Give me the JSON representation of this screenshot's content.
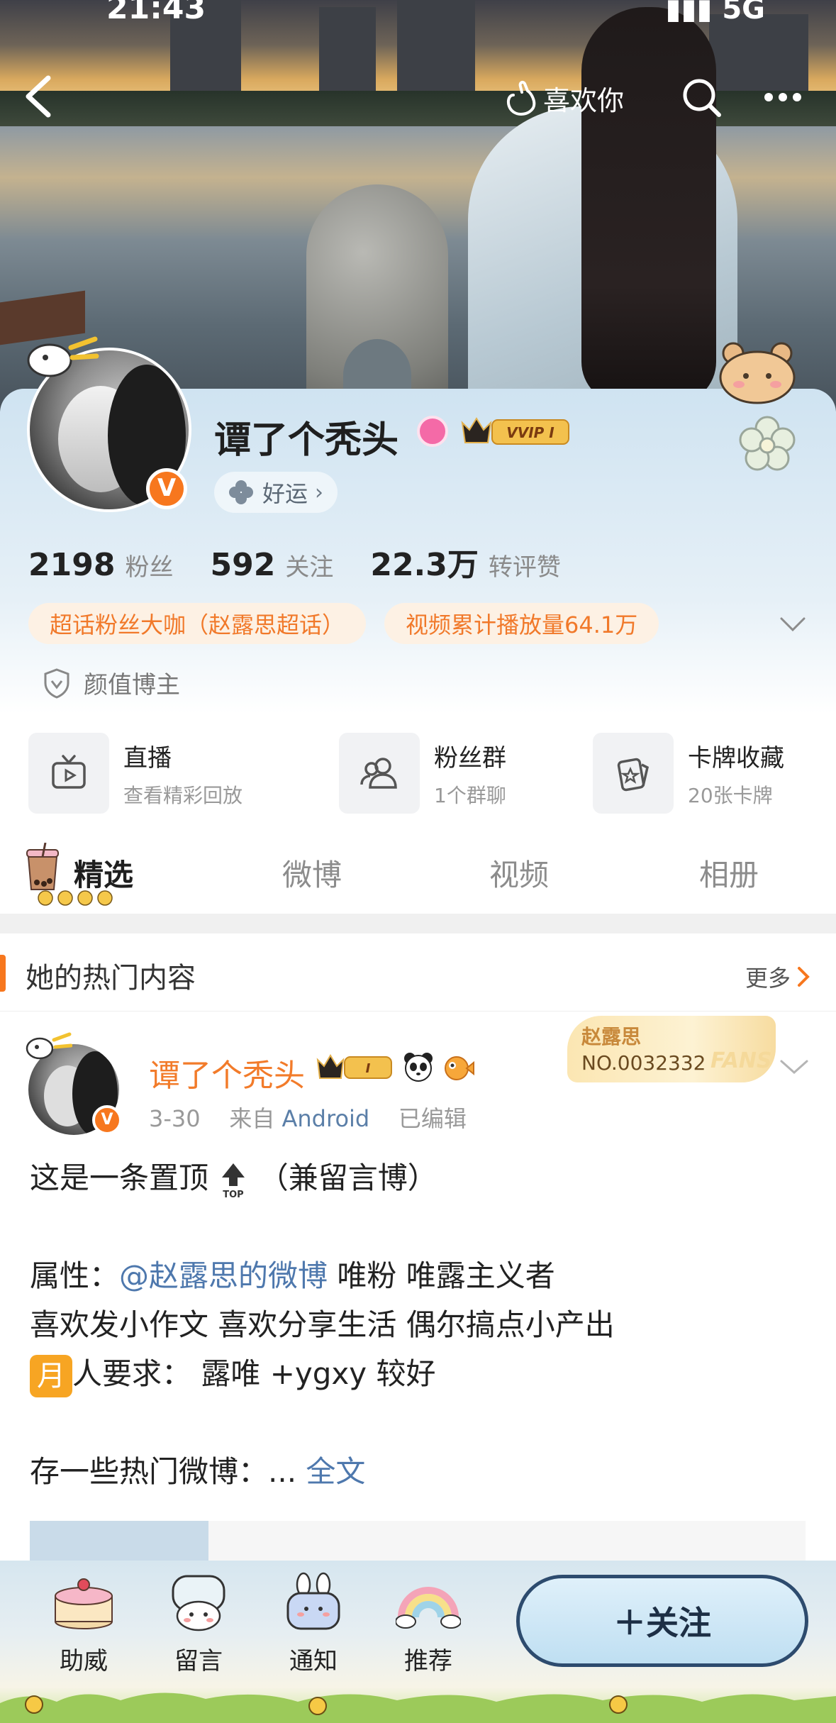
{
  "status_bar": {
    "time": "21:43",
    "network": "5G"
  },
  "top_nav": {
    "like_label": "喜欢你"
  },
  "profile": {
    "name": "谭了个秃头",
    "vip_label": "VVIP I",
    "luck_label": "好运",
    "verified_badge": "V",
    "stats": [
      {
        "num": "2198",
        "label": "粉丝"
      },
      {
        "num": "592",
        "label": "关注"
      },
      {
        "num": "22.3万",
        "label": "转评赞"
      }
    ],
    "tags": [
      "超话粉丝大咖（赵露思超话）",
      "视频累计播放量64.1万"
    ],
    "certification": "颜值博主"
  },
  "services": [
    {
      "title": "直播",
      "sub": "查看精彩回放",
      "icon": "tv-icon"
    },
    {
      "title": "粉丝群",
      "sub": "1个群聊",
      "icon": "group-icon"
    },
    {
      "title": "卡牌收藏",
      "sub": "20张卡牌",
      "icon": "card-icon"
    }
  ],
  "tabs": [
    "精选",
    "微博",
    "视频",
    "相册"
  ],
  "hot_section": {
    "title": "她的热门内容",
    "more": "更多"
  },
  "post": {
    "author": "谭了个秃头",
    "badge_level": "I",
    "date": "3-30",
    "source_prefix": "来自",
    "source": "Android",
    "edited": "已编辑",
    "fans_card": {
      "name": "赵露思",
      "number": "NO.0032332",
      "watermark": "FANS"
    },
    "line1_a": "这是一条置顶",
    "line1_b": "（兼留言博）",
    "line2_a": "属性：",
    "line2_mention": "@赵露思的微博",
    "line2_b": " 唯粉 唯露主义者",
    "line3": "喜欢发小作文 喜欢分享生活 偶尔搞点小产出",
    "line4_icon": "月",
    "line4": "人要求：  露唯 +ygxy 较好",
    "line5": "存一些热门微博：... ",
    "full_text": "全文"
  },
  "bottom_bar": {
    "items": [
      "助威",
      "留言",
      "通知",
      "推荐"
    ],
    "follow_label": "＋关注"
  },
  "colors": {
    "accent": "#f7771e",
    "link": "#4e78ad",
    "name_orange": "#f27b2a"
  }
}
